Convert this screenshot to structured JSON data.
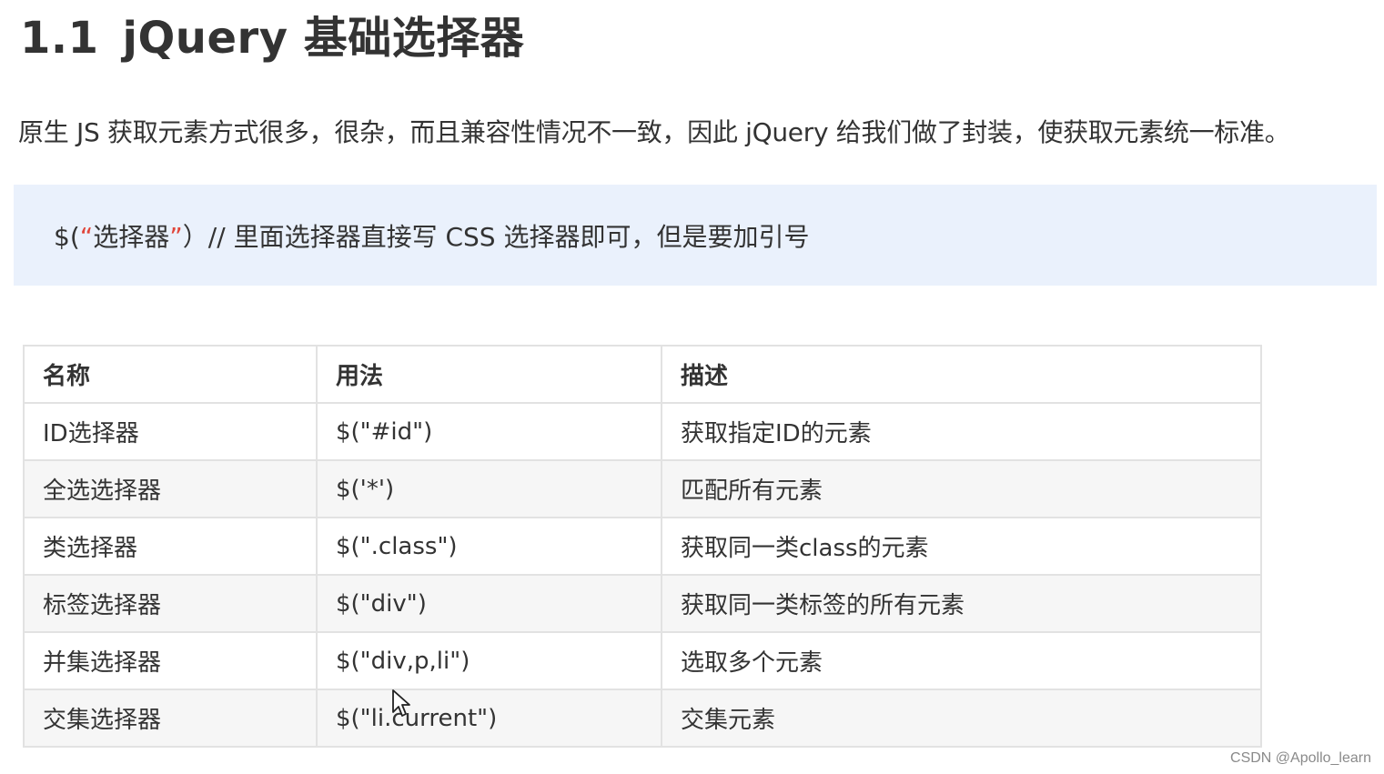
{
  "heading": {
    "number": "1.1",
    "title": "jQuery 基础选择器"
  },
  "intro": "原生 JS 获取元素方式很多，很杂，而且兼容性情况不一致，因此 jQuery 给我们做了封装，使获取元素统一标准。",
  "code": {
    "prefix": "$(",
    "quote_open": "“",
    "arg": "选择器",
    "quote_close": "”",
    "suffix": "）// 里面选择器直接写 CSS 选择器即可，但是要加引号"
  },
  "table": {
    "headers": [
      "名称",
      "用法",
      "描述"
    ],
    "rows": [
      [
        "ID选择器",
        "$(\"#id\")",
        "获取指定ID的元素"
      ],
      [
        "全选选择器",
        "$('*')",
        "匹配所有元素"
      ],
      [
        "类选择器",
        "$(\".class\")",
        "获取同一类class的元素"
      ],
      [
        "标签选择器",
        "$(\"div\")",
        "获取同一类标签的所有元素"
      ],
      [
        "并集选择器",
        "$(\"div,p,li\")",
        "选取多个元素"
      ],
      [
        "交集选择器",
        "$(\"li.current\")",
        "交集元素"
      ]
    ]
  },
  "watermark": "CSDN @Apollo_learn",
  "icons": {
    "cursor": "mouse-pointer-icon"
  },
  "colors": {
    "code_box_bg": "#eaf1fc",
    "quote_red": "#e0453a",
    "row_alt_bg": "#f6f6f6",
    "border": "#e2e2e2",
    "text": "#333333"
  }
}
